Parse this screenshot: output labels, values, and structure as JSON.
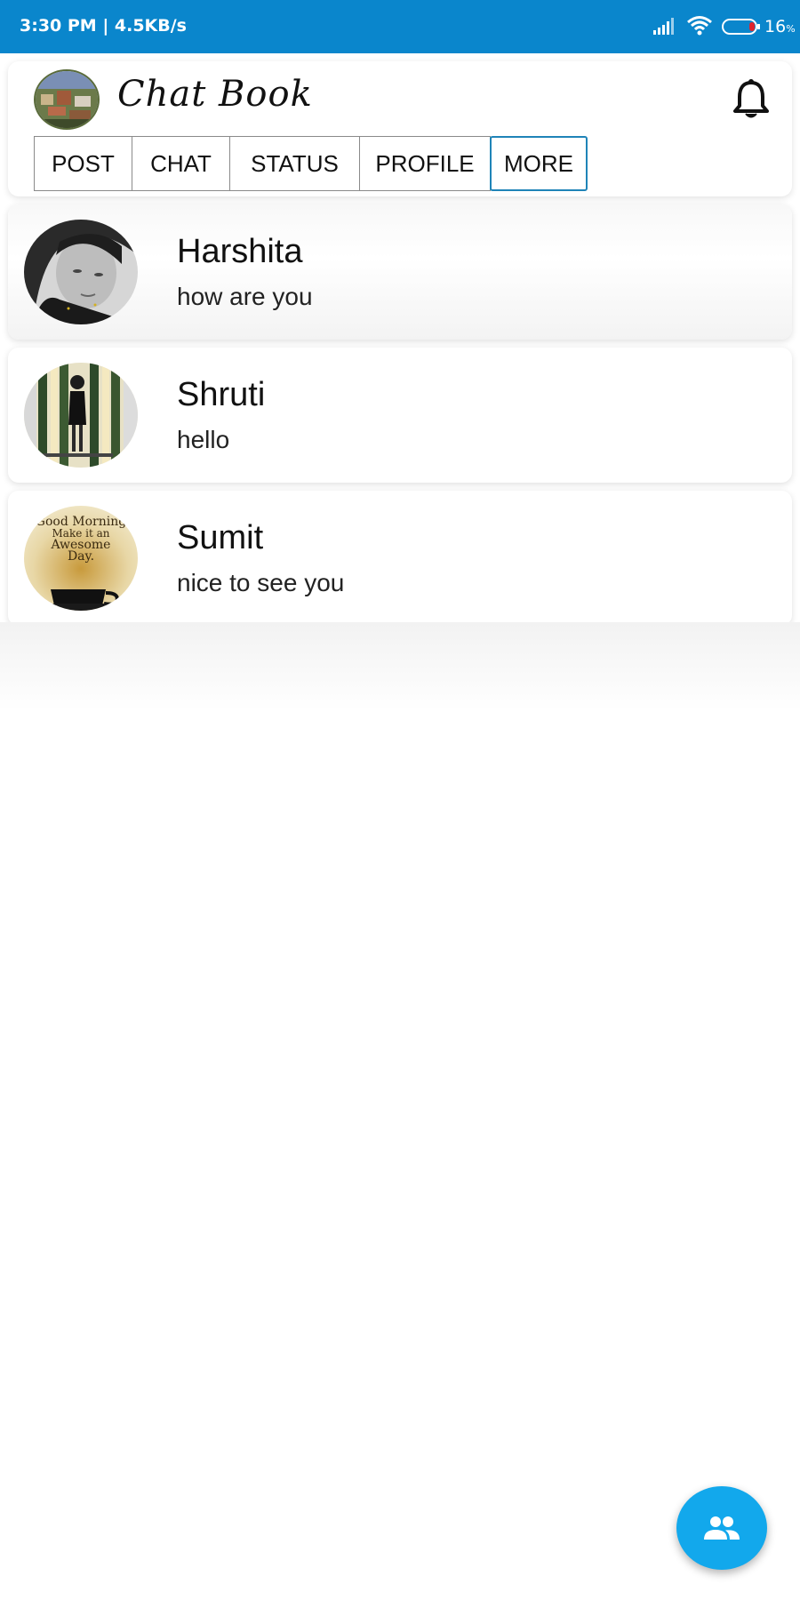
{
  "status_bar": {
    "time_speed": "3:30 PM | 4.5KB/s",
    "battery_level": "16",
    "battery_unit": "%"
  },
  "header": {
    "app_title": "Chat Book",
    "tabs": [
      {
        "label": "POST",
        "active": false
      },
      {
        "label": "CHAT",
        "active": false
      },
      {
        "label": "STATUS",
        "active": false
      },
      {
        "label": "PROFILE",
        "active": false
      },
      {
        "label": "MORE",
        "active": true
      }
    ]
  },
  "chats": [
    {
      "name": "Harshita",
      "message": "how are you"
    },
    {
      "name": "Shruti",
      "message": "hello"
    },
    {
      "name": "Sumit",
      "message": "nice to see you"
    }
  ],
  "avatar_texts": {
    "sumit_image_text_1": "Good Morning",
    "sumit_image_text_2": "Make it an",
    "sumit_image_text_3": "Awesome",
    "sumit_image_text_4": "Day."
  },
  "colors": {
    "status_bar": "#0a86cc",
    "fab": "#12a8ec",
    "active_tab_border": "#1f84b8"
  },
  "icons": {
    "signal": "signal-icon",
    "wifi": "wifi-icon",
    "battery": "battery-icon",
    "notification": "bell-icon",
    "fab": "group-icon"
  }
}
